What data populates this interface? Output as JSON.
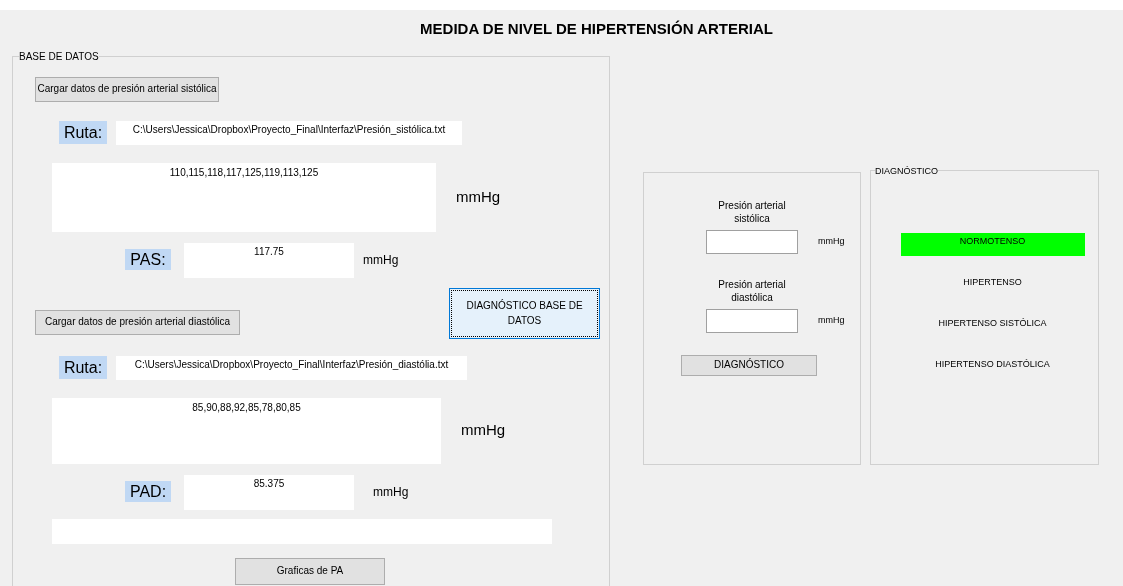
{
  "title": "MEDIDA DE NIVEL DE HIPERTENSIÓN ARTERIAL",
  "database": {
    "legend": "BASE DE DATOS",
    "load_systolic_button": "Cargar datos de presión arterial sistólica",
    "systolic": {
      "path_label": "Ruta:",
      "path": "C:\\Users\\Jessica\\Dropbox\\Proyecto_Final\\Interfaz\\Presión_sistólica.txt",
      "data": "110,115,118,117,125,119,113,125",
      "data_unit": "mmHg",
      "mean_label": "PAS:",
      "mean": "117.75",
      "mean_unit": "mmHg"
    },
    "diagnose_button": "DIAGNÓSTICO BASE DE DATOS",
    "load_diastolic_button": "Cargar datos de presión arterial diastólica",
    "diastolic": {
      "path_label": "Ruta:",
      "path": "C:\\Users\\Jessica\\Dropbox\\Proyecto_Final\\Interfaz\\Presión_diastólia.txt",
      "data": "85,90,88,92,85,78,80,85",
      "data_unit": "mmHg",
      "mean_label": "PAD:",
      "mean": "85.375",
      "mean_unit": "mmHg"
    },
    "plot_button": "Graficas de PA"
  },
  "manual": {
    "fields": [
      {
        "label": "Presión arterial sistólica",
        "unit": "mmHg"
      },
      {
        "label": "Presión arterial diastólica",
        "unit": "mmHg"
      }
    ],
    "button": "DIAGNÓSTICO"
  },
  "diagnosis": {
    "legend": "DIAGNÓSTICO",
    "results": [
      {
        "label": "NORMOTENSO",
        "selected": true
      },
      {
        "label": "HIPERTENSO",
        "selected": false
      },
      {
        "label": "HIPERTENSO SISTÓLICA",
        "selected": false
      },
      {
        "label": "HIPERTENSO DIASTÓLICA",
        "selected": false
      }
    ]
  }
}
